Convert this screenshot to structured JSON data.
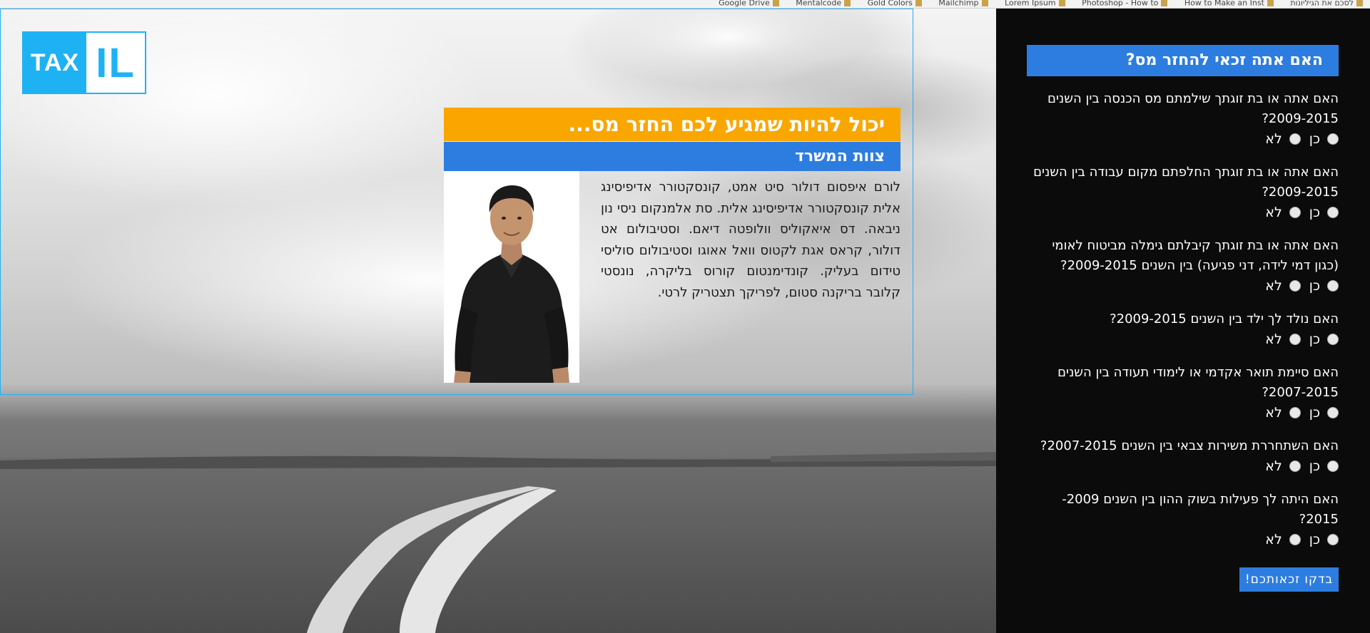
{
  "browser": {
    "bookmarks": [
      "לסכם את הגיליונות",
      "How to Make an Inst",
      "Photoshop - How to",
      "Lorem Ipsum",
      "Mailchimp",
      "Gold Colors",
      "Mentalcode",
      "Google Drive"
    ]
  },
  "logo": {
    "left_text": "TAX",
    "right_text": "IL"
  },
  "hero": {
    "headline": "יכול להיות שמגיע לכם החזר מס...",
    "subheadline": "צוות המשרד",
    "bio": "לורם איפסום דולור סיט אמט, קונסקטורר אדיפיסינג אלית קונסקטורר אדיפיסינג אלית. סת אלמנקום ניסי נון ניבאה. דס איאקוליס וולופטה דיאם. וסטיבולום אט דולור, קראס אגת לקטוס וואל אאוגו וסטיבולום סוליסי טידום בעליק. קונדימנטום קורוס בליקרה, נונסטי קלובר בריקנה סטום, לפריקך תצטריק לרטי."
  },
  "sidebar": {
    "title": "האם אתה זכאי להחזר מס?",
    "yes_label": "כן",
    "no_label": "לא",
    "questions": [
      "האם אתה או בת זוגתך שילמתם מס הכנסה בין השנים 2009-2015?",
      "האם אתה או בת זוגתך החלפתם מקום עבודה בין השנים 2009-2015?",
      "האם אתה או בת זוגתך קיבלתם גימלה מביטוח לאומי (כגון דמי לידה, דני פגיעה) בין השנים 2009-2015?",
      "האם נולד לך ילד בין השנים 2009-2015?",
      "האם סיימת תואר אקדמי או לימודי תעודה בין השנים 2007-2015?",
      "האם השתחררת משירות צבאי בין השנים 2007-2015?",
      "האם היתה לך פעילות בשוק ההון בין השנים 2009- 2015?"
    ],
    "submit_label": "בדקו זכאותכם!"
  },
  "colors": {
    "brand_blue": "#2d7de0",
    "logo_blue": "#1eb2f5",
    "headline_orange": "#f9a600",
    "sidebar_bg": "#0b0b0b"
  }
}
